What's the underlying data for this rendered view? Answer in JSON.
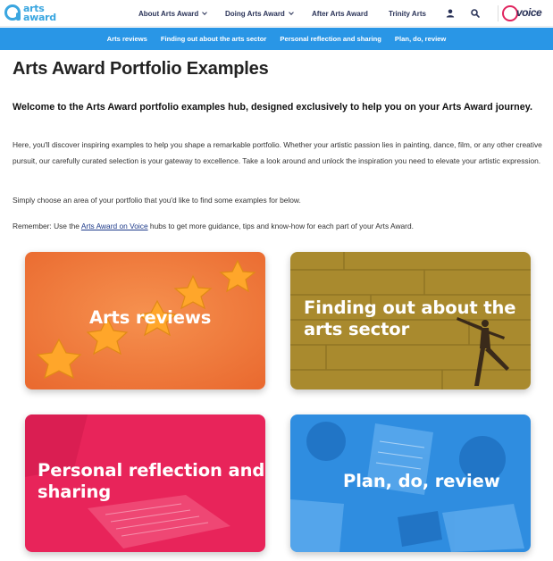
{
  "header": {
    "logo_line1": "arts",
    "logo_line2": "award",
    "nav": [
      {
        "label": "About Arts Award",
        "dropdown": true
      },
      {
        "label": "Doing Arts Award",
        "dropdown": true
      },
      {
        "label": "After Arts Award",
        "dropdown": false
      },
      {
        "label": "Trinity Arts",
        "dropdown": false
      }
    ],
    "user_icon": "user-icon",
    "search_icon": "search-icon",
    "voice_logo": "voice"
  },
  "subnav": [
    "Arts reviews",
    "Finding out about the arts sector",
    "Personal reflection and sharing",
    "Plan, do, review"
  ],
  "content": {
    "title": "Arts Award Portfolio Examples",
    "intro": "Welcome to the Arts Award portfolio examples hub, designed exclusively to help you on your Arts Award journey.",
    "p1": "Here, you'll discover inspiring examples to help you shape a remarkable portfolio. Whether your artistic passion lies in painting, dance, film, or any other creative pursuit, our carefully curated selection is your gateway to excellence. Take a look around and unlock the inspiration you need to elevate your artistic expression.",
    "p2": "Simply choose an area of your portfolio that you'd like to find some examples for below.",
    "p3_before": "Remember: Use the ",
    "p3_link": "Arts Award on Voice",
    "p3_after": " hubs to get more guidance, tips and know-how for each part of your Arts Award."
  },
  "cards": [
    {
      "label": "Arts reviews",
      "color": "#f07a3c"
    },
    {
      "label": "Finding out about the arts sector",
      "color": "#a98a2e"
    },
    {
      "label": "Personal reflection and sharing",
      "color": "#e8245a"
    },
    {
      "label": "Plan, do, review",
      "color": "#2f8de0"
    }
  ],
  "colors": {
    "brand_blue": "#2996e6",
    "navy": "#2a3358",
    "voice_pink": "#e0245e"
  }
}
